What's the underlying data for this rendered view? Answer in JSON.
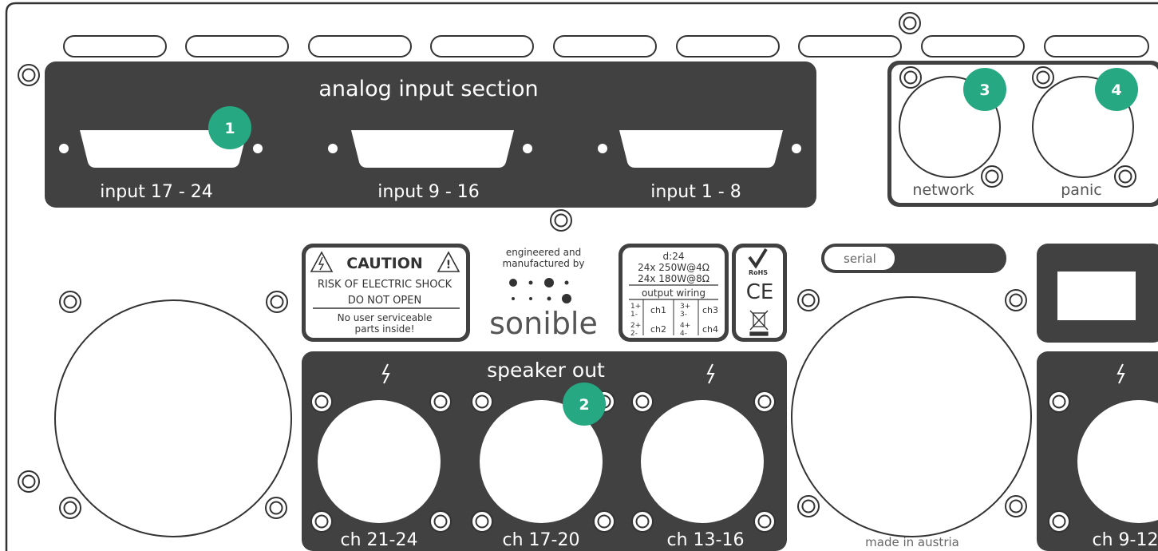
{
  "analog_section": {
    "title": "analog input section",
    "inputs": [
      "input 17 - 24",
      "input  9 - 16",
      "input 1 - 8"
    ]
  },
  "ports": {
    "network": "network",
    "panic": "panic"
  },
  "caution_label": {
    "title": "CAUTION",
    "line1": "RISK OF ELECTRIC SHOCK",
    "line2": "DO NOT OPEN",
    "line3": "No user serviceable",
    "line4": "parts inside!"
  },
  "maker": {
    "line1": "engineered and",
    "line2": "manufactured by",
    "brand": "sonible"
  },
  "spec_label": {
    "model": "d:24",
    "rating1": "24x 250W@4Ω",
    "rating2": "24x 180W@8Ω",
    "wiring_title": "output wiring",
    "pins1": "1+",
    "pins1b": "1-",
    "ch1": "ch1",
    "pins3": "3+",
    "pins3b": "3-",
    "ch3": "ch3",
    "pins2": "2+",
    "pins2b": "2-",
    "ch2": "ch2",
    "pins4": "4+",
    "pins4b": "4-",
    "ch4": "ch4"
  },
  "compliance": {
    "rohs": "RoHS",
    "ce": "CE"
  },
  "serial": {
    "label": "serial"
  },
  "speaker_section": {
    "title": "speaker out",
    "channels": [
      "ch 21-24",
      "ch 17-20",
      "ch 13-16",
      "ch 9-12"
    ]
  },
  "footer": {
    "made_in": "made in austria"
  },
  "callouts": [
    "1",
    "2",
    "3",
    "4"
  ],
  "colors": {
    "panel_dark": "#414141",
    "callout": "#26a882",
    "outline": "#333333"
  }
}
